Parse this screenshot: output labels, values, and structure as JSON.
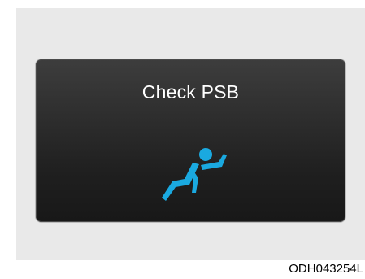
{
  "display": {
    "message": "Check PSB",
    "icon": "seatbelt-warning-icon",
    "icon_color": "#1aa9e0",
    "background_color": "#262626"
  },
  "figure_code": "ODH043254L"
}
